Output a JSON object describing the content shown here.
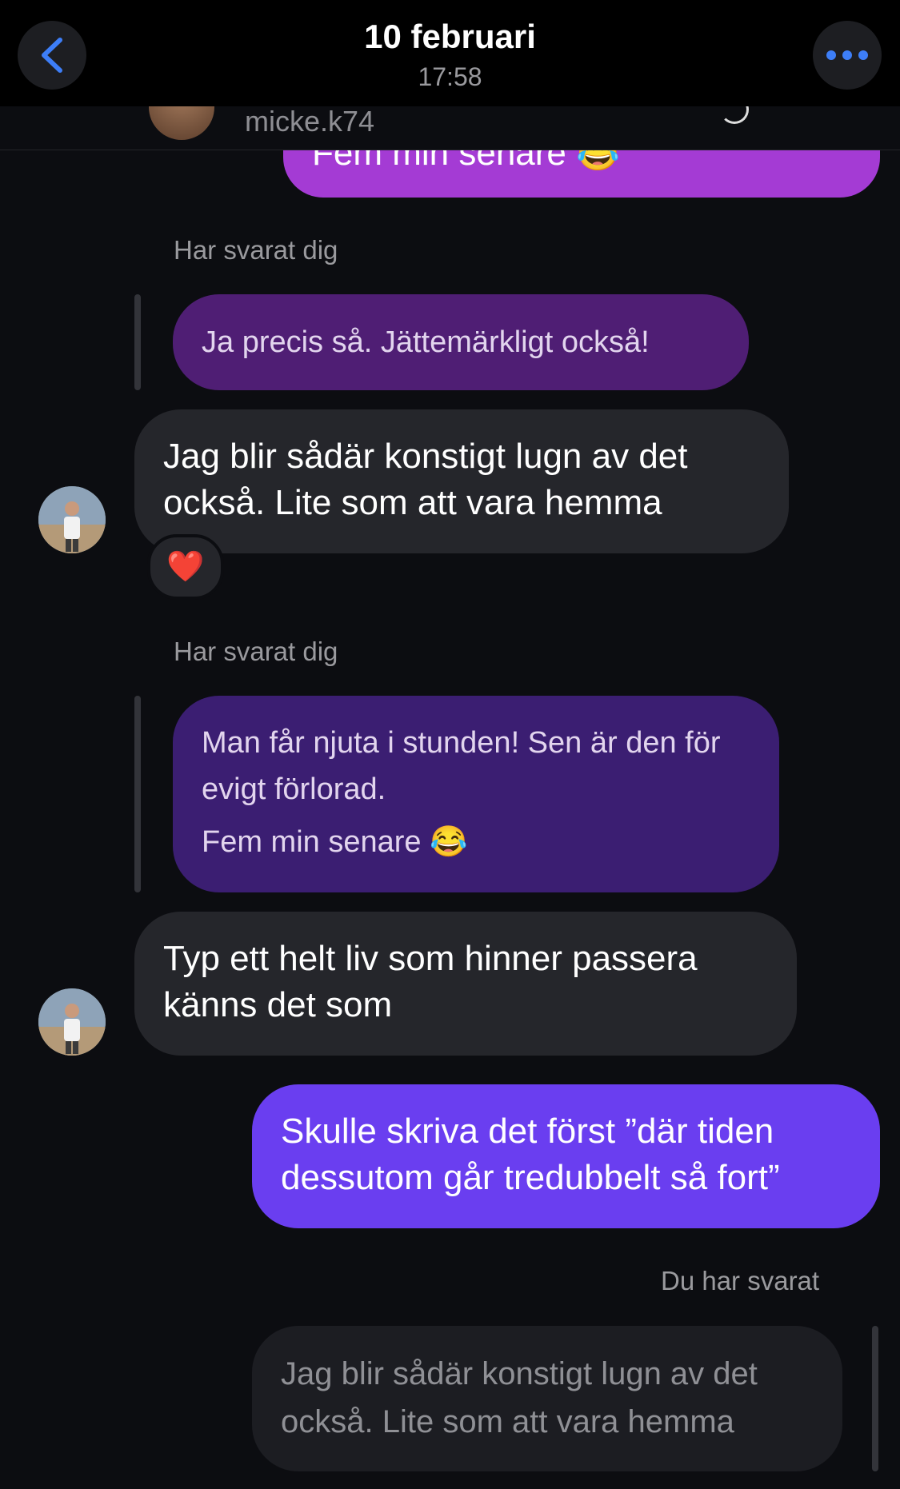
{
  "header": {
    "title": "10 februari",
    "time": "17:58",
    "username": "micke.k74"
  },
  "colors": {
    "sent_bubble": "#6a3ef0",
    "received_bubble": "#25262b",
    "quoted_bubble": "#4f1e74",
    "accent_icon": "#3d7ef7"
  },
  "icons": {
    "back": "chevron-left-icon",
    "more": "ellipsis-icon",
    "reaction": "red-heart-emoji",
    "laugh": "face-with-tears-of-joy-emoji"
  },
  "messages": {
    "top_partial": "Fem min senare 😂",
    "reply_label_1": "Har svarat dig",
    "quoted_1": "Ja precis så. Jättemärkligt också!",
    "received_1": "Jag blir sådär konstigt lugn av det också. Lite som att vara hemma",
    "reaction_1": "❤️",
    "reply_label_2": "Har svarat dig",
    "quoted_2_line1": "Man får njuta i stunden! Sen är den för evigt förlorad.",
    "quoted_2_line2": "Fem min senare 😂",
    "received_2": "Typ ett helt liv som hinner passera känns det som",
    "sent_1": "Skulle skriva det först ”där tiden dessutom går tredubbelt så fort”",
    "own_reply_label": "Du har svarat",
    "own_quoted": "Jag blir sådär konstigt lugn av det också. Lite som att vara hemma"
  }
}
